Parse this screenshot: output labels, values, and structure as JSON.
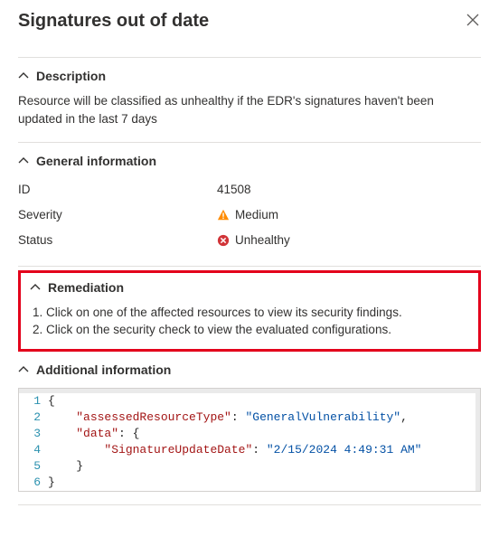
{
  "header": {
    "title": "Signatures out of date"
  },
  "sections": {
    "description": {
      "title": "Description",
      "body": "Resource will be classified as unhealthy if the EDR's signatures haven't been updated in the last 7 days"
    },
    "general": {
      "title": "General information",
      "rows": {
        "id_label": "ID",
        "id_value": "41508",
        "severity_label": "Severity",
        "severity_value": "Medium",
        "status_label": "Status",
        "status_value": "Unhealthy"
      }
    },
    "remediation": {
      "title": "Remediation",
      "step1": "Click on one of the affected resources to view its security findings.",
      "step2": "Click on the security check to view the evaluated configurations."
    },
    "additional": {
      "title": "Additional information",
      "json_lines": {
        "l1": "{",
        "l2_k": "\"assessedResourceType\"",
        "l2_v": "\"GeneralVulnerability\"",
        "l3_k": "\"data\"",
        "l4_k": "\"SignatureUpdateDate\"",
        "l4_v": "\"2/15/2024 4:49:31 AM\"",
        "l5": "    }",
        "l6": "}"
      }
    }
  }
}
